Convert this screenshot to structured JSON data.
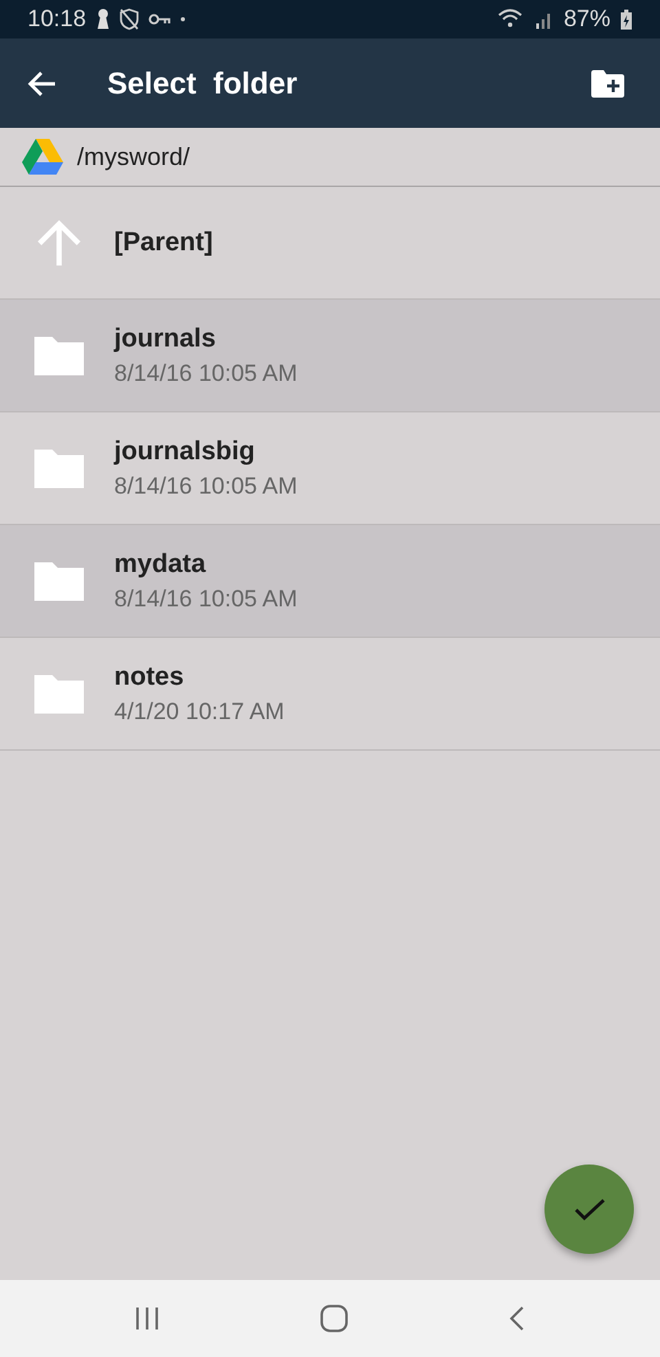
{
  "status_bar": {
    "time": "10:18",
    "battery": "87%"
  },
  "app_bar": {
    "title": "Select  folder"
  },
  "path": "/mysword/",
  "rows": [
    {
      "kind": "parent",
      "name": "[Parent]"
    },
    {
      "kind": "folder",
      "name": "journals",
      "date": "8/14/16 10:05 AM"
    },
    {
      "kind": "folder",
      "name": "journalsbig",
      "date": "8/14/16 10:05 AM"
    },
    {
      "kind": "folder",
      "name": "mydata",
      "date": "8/14/16 10:05 AM"
    },
    {
      "kind": "folder",
      "name": "notes",
      "date": "4/1/20 10:17 AM"
    }
  ]
}
